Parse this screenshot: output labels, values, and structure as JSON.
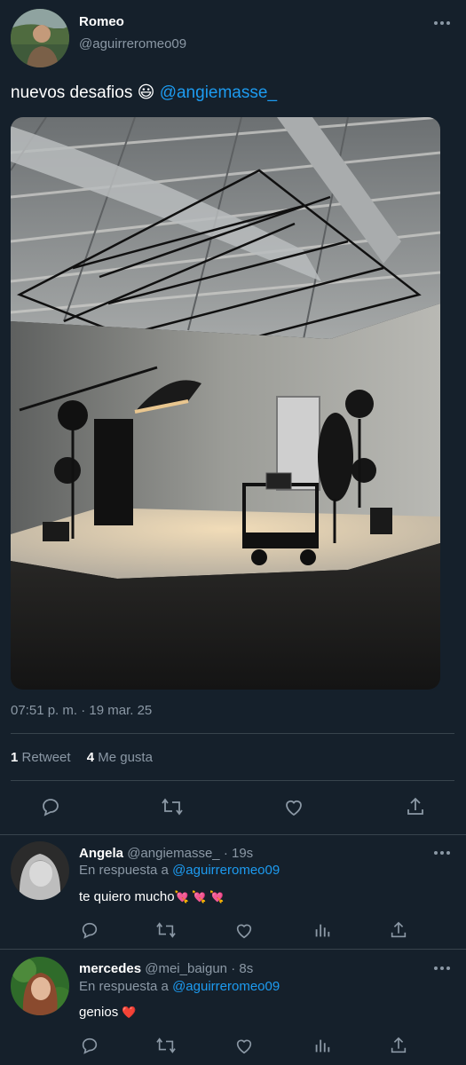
{
  "tweet": {
    "author_name": "Romeo",
    "author_handle": "@aguirreromeo09",
    "text_main": "nuevos desafios",
    "emoji": "😃",
    "mention": "@angiemasse_",
    "timestamp": "07:51 p. m. · 19 mar. 25",
    "retweet_count": "1",
    "retweet_label": "Retweet",
    "like_count": "4",
    "like_label": "Me gusta",
    "more_icon": "more-icon"
  },
  "replies": [
    {
      "name": "Angela",
      "handle": "@angiemasse_",
      "time": "· 19s",
      "reply_prefix": "En respuesta a",
      "reply_to": "@aguirreromeo09",
      "text": "te quiero mucho",
      "emojis": "💘 💘 💘"
    },
    {
      "name": "mercedes",
      "handle": "@mei_baigun",
      "time": "· 8s",
      "reply_prefix": "En respuesta a",
      "reply_to": "@aguirreromeo09",
      "text": "genios",
      "emojis": "❤️"
    }
  ],
  "colors": {
    "background": "#15202b",
    "accent": "#1d9bf0",
    "muted": "#8b98a5",
    "divider": "#38444d",
    "heart": "#f91880"
  }
}
